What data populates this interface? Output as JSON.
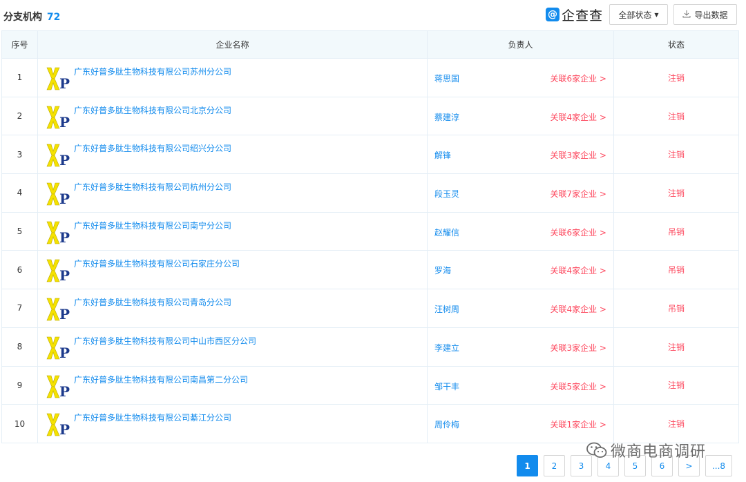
{
  "header": {
    "title": "分支机构",
    "count": "72",
    "brand_badge": "@",
    "brand_text": "企查查",
    "status_button": "全部状态",
    "export_button": "导出数据"
  },
  "table": {
    "columns": [
      "序号",
      "企业名称",
      "负责人",
      "状态"
    ],
    "rows": [
      {
        "index": "1",
        "company": "广东好普多肽生物科技有限公司苏州分公司",
        "person": "蒋思国",
        "related": "关联6家企业 >",
        "status": "注销"
      },
      {
        "index": "2",
        "company": "广东好普多肽生物科技有限公司北京分公司",
        "person": "蔡建淳",
        "related": "关联4家企业 >",
        "status": "注销"
      },
      {
        "index": "3",
        "company": "广东好普多肽生物科技有限公司绍兴分公司",
        "person": "解锋",
        "related": "关联3家企业 >",
        "status": "注销"
      },
      {
        "index": "4",
        "company": "广东好普多肽生物科技有限公司杭州分公司",
        "person": "段玉灵",
        "related": "关联7家企业 >",
        "status": "注销"
      },
      {
        "index": "5",
        "company": "广东好普多肽生物科技有限公司南宁分公司",
        "person": "赵耀信",
        "related": "关联6家企业 >",
        "status": "吊销"
      },
      {
        "index": "6",
        "company": "广东好普多肽生物科技有限公司石家庄分公司",
        "person": "罗海",
        "related": "关联4家企业 >",
        "status": "吊销"
      },
      {
        "index": "7",
        "company": "广东好普多肽生物科技有限公司青岛分公司",
        "person": "汪树周",
        "related": "关联4家企业 >",
        "status": "吊销"
      },
      {
        "index": "8",
        "company": "广东好普多肽生物科技有限公司中山市西区分公司",
        "person": "李建立",
        "related": "关联3家企业 >",
        "status": "注销"
      },
      {
        "index": "9",
        "company": "广东好普多肽生物科技有限公司南昌第二分公司",
        "person": "邹干丰",
        "related": "关联5家企业 >",
        "status": "注销"
      },
      {
        "index": "10",
        "company": "广东好普多肽生物科技有限公司綦江分公司",
        "person": "周伶梅",
        "related": "关联1家企业 >",
        "status": "注销"
      }
    ]
  },
  "pagination": {
    "pages": [
      "1",
      "2",
      "3",
      "4",
      "5",
      "6"
    ],
    "next": ">",
    "last": "...8",
    "current": "1"
  },
  "watermark": {
    "text": "微商电商调研"
  },
  "colors": {
    "accent": "#128bed",
    "danger": "#fd485e",
    "header_bg": "#f2f9fc",
    "logo_yellow": "#f5e200",
    "logo_blue": "#1c3a8c"
  }
}
